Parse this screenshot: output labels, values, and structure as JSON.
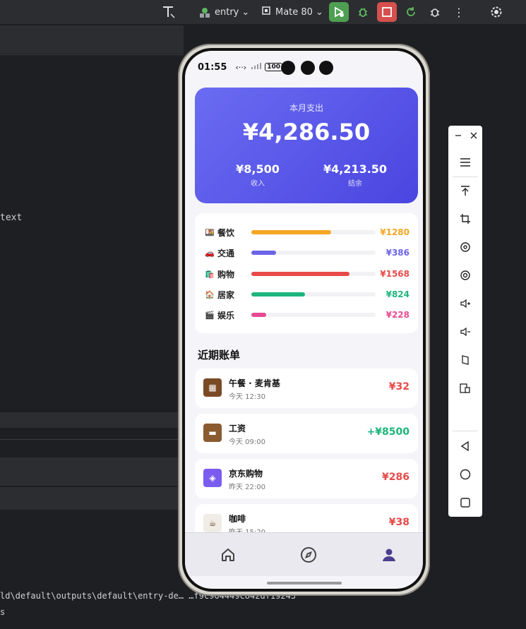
{
  "ide": {
    "toolbar": {
      "module": "entry",
      "device": "Mate 80"
    },
    "text_fragment": "text",
    "output_line": "ld\\default\\outputs\\default\\entry-de…                    …f9c964449c842df19243",
    "output_line2": "s"
  },
  "phone": {
    "status": {
      "time": "01:55",
      "battery": "100"
    },
    "hero": {
      "label": "本月支出",
      "amount": "¥4,286.50",
      "income_value": "¥8,500",
      "income_label": "收入",
      "balance_value": "¥4,213.50",
      "balance_label": "结余"
    },
    "categories": [
      {
        "emoji": "🍱",
        "name": "餐饮",
        "amount": "¥1280",
        "ratio": 0.64,
        "color": "#f5a623"
      },
      {
        "emoji": "🚗",
        "name": "交通",
        "amount": "¥386",
        "ratio": 0.2,
        "color": "#6c63e8"
      },
      {
        "emoji": "🛍️",
        "name": "购物",
        "amount": "¥1568",
        "ratio": 0.79,
        "color": "#e84a4a"
      },
      {
        "emoji": "🏠",
        "name": "居家",
        "amount": "¥824",
        "ratio": 0.43,
        "color": "#1db57d"
      },
      {
        "emoji": "🎬",
        "name": "娱乐",
        "amount": "¥228",
        "ratio": 0.12,
        "color": "#e84a92"
      }
    ],
    "recent_title": "近期账单",
    "bills": [
      {
        "title": "午餐 · 麦肯基",
        "time": "今天 12:30",
        "amount": "¥32",
        "color": "#e84a4a"
      },
      {
        "title": "工资",
        "time": "今天 09:00",
        "amount": "+¥8500",
        "color": "#1db57d"
      },
      {
        "title": "京东购物",
        "time": "昨天 22:00",
        "amount": "¥286",
        "color": "#e84a4a"
      },
      {
        "title": "咖啡",
        "time": "昨天 15:20",
        "amount": "¥38",
        "color": "#e84a4a"
      }
    ]
  }
}
